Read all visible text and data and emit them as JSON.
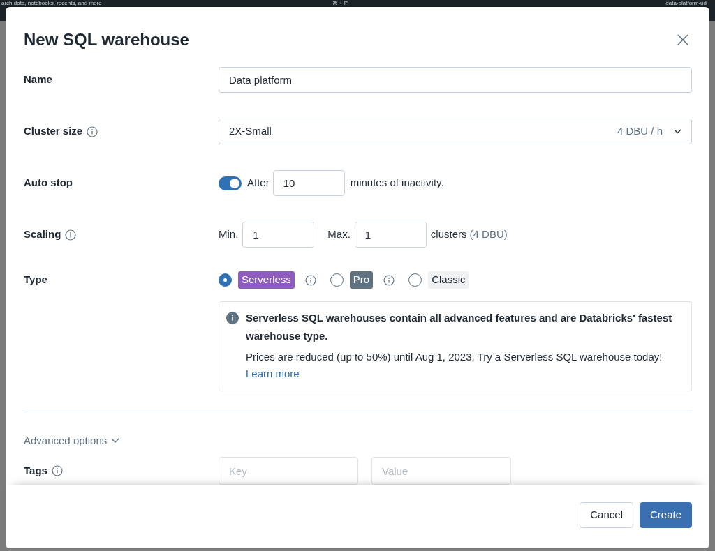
{
  "background": {
    "search_hint": "arch data, notebooks, recents, and more",
    "shortcut": "⌘ + P",
    "workspace": "data-platform-ud"
  },
  "dialog": {
    "title": "New SQL warehouse"
  },
  "name": {
    "label": "Name",
    "value": "Data platform"
  },
  "cluster_size": {
    "label": "Cluster size",
    "value": "2X-Small",
    "rate": "4 DBU / h"
  },
  "auto_stop": {
    "label": "Auto stop",
    "on": true,
    "prefix": "After",
    "value": "10",
    "suffix": "minutes of inactivity."
  },
  "scaling": {
    "label": "Scaling",
    "min_label": "Min.",
    "min_value": "1",
    "max_label": "Max.",
    "max_value": "1",
    "suffix": "clusters",
    "cost": "(4 DBU)"
  },
  "type": {
    "label": "Type",
    "options": [
      {
        "label": "Serverless",
        "selected": true,
        "color": "#8e5cbf",
        "info_icon": true
      },
      {
        "label": "Pro",
        "selected": false,
        "color": "#5f7281",
        "info_icon": true
      },
      {
        "label": "Classic",
        "selected": false,
        "color": "#f0f1f3",
        "info_icon": false
      }
    ]
  },
  "notice": {
    "title": "Serverless SQL warehouses contain all advanced features and are Databricks' fastest warehouse type.",
    "body": "Prices are reduced (up to 50%) until Aug 1, 2023. Try a Serverless SQL warehouse today!",
    "link": "Learn more"
  },
  "advanced": {
    "label": "Advanced options"
  },
  "tags": {
    "label": "Tags",
    "key_placeholder": "Key",
    "value_placeholder": "Value"
  },
  "buttons": [
    {
      "label": "Cancel",
      "kind": "secondary"
    },
    {
      "label": "Create",
      "kind": "primary"
    }
  ]
}
